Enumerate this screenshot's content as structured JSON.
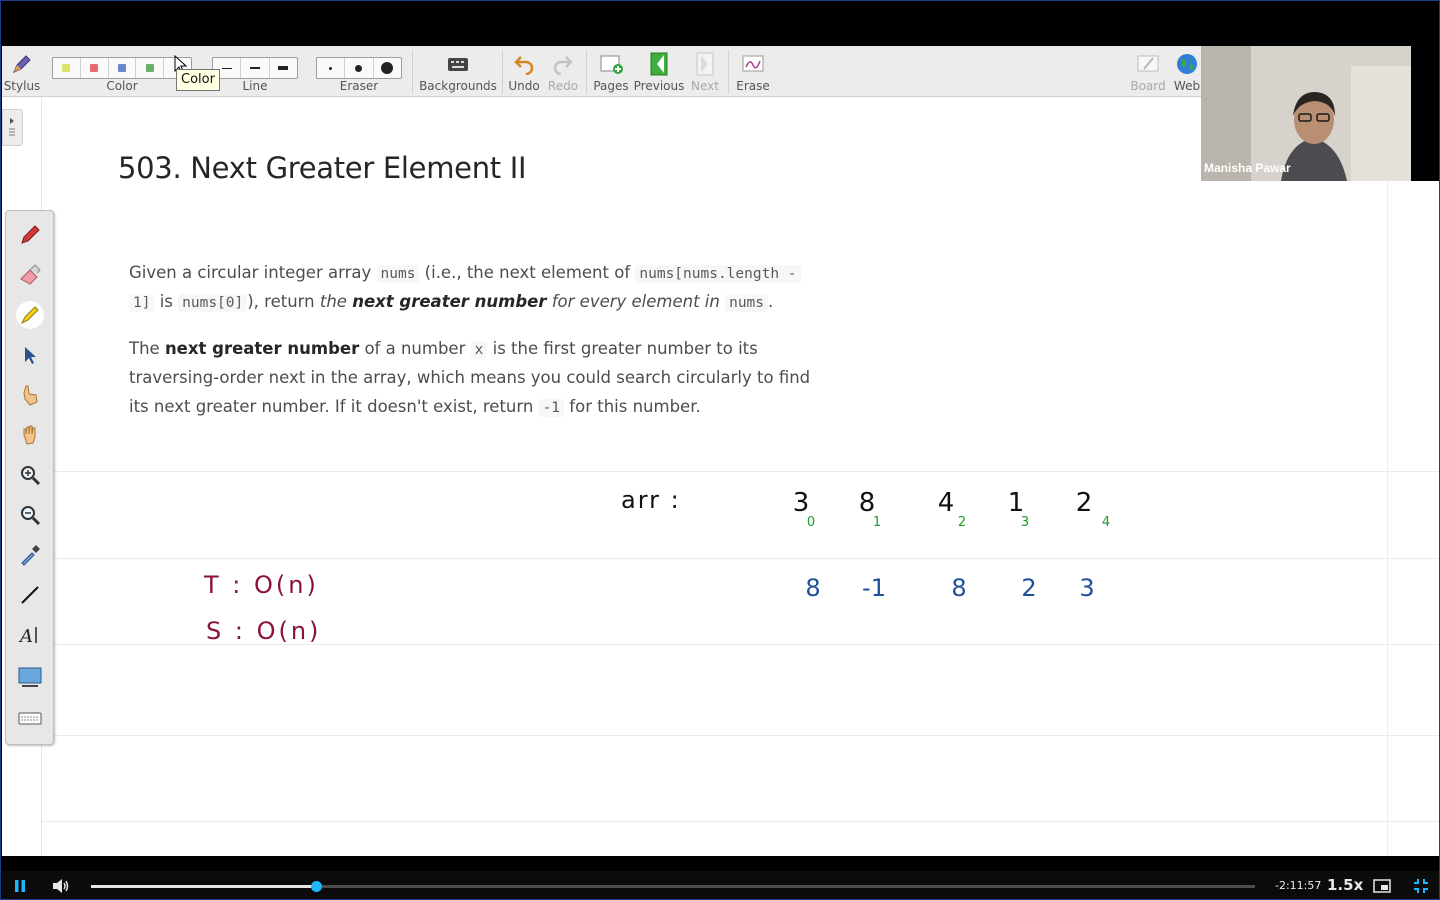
{
  "toolbar": {
    "stylus_label": "Stylus",
    "color_label": "Color",
    "color_swatches": [
      "#dce26b",
      "#e86a6a",
      "#6a86c8",
      "#6ab06a"
    ],
    "line_label": "Line",
    "eraser_label": "Eraser",
    "backgrounds_label": "Backgrounds",
    "undo_label": "Undo",
    "redo_label": "Redo",
    "pages_label": "Pages",
    "previous_label": "Previous",
    "next_label": "Next",
    "erase_label": "Erase",
    "board_label": "Board",
    "web_label": "Web"
  },
  "tooltip": {
    "text": "Color"
  },
  "webcam": {
    "name": "Manisha Pawar"
  },
  "problem": {
    "title": "503. Next Greater Element II",
    "p1_a": "Given a circular integer array ",
    "p1_code1": "nums",
    "p1_b": " (i.e., the next element of ",
    "p1_code2": "nums[nums.length -",
    "p1_code3": "1]",
    "p1_c": " is ",
    "p1_code4": "nums[0]",
    "p1_d": "), return ",
    "p1_e": "the ",
    "p1_f": "next greater number",
    "p1_g": " for every element in ",
    "p1_code5": "nums",
    "p1_h": ".",
    "p2_a": "The ",
    "p2_b": "next greater number",
    "p2_c": " of a number ",
    "p2_code1": "x",
    "p2_d": " is the first greater number to its",
    "p2_line2": "traversing-order next in the array, which means you could search circularly to find",
    "p2_e": "its next greater number. If it doesn't exist, return ",
    "p2_code2": "-1",
    "p2_f": " for this number."
  },
  "handwriting": {
    "arr_label": "arr :",
    "values": [
      "3",
      "8",
      "4",
      "1",
      "2"
    ],
    "indices": [
      "0",
      "1",
      "2",
      "3",
      "4"
    ],
    "results": [
      "8",
      "-1",
      "8",
      "2",
      "3"
    ],
    "time_complexity": "T : O(n)",
    "space_complexity": "S : O(n)",
    "colors": {
      "black": "#111111",
      "green": "#1d9a2a",
      "blue": "#1f4f9a",
      "maroon": "#8a1238"
    }
  },
  "player": {
    "progress": 0.193,
    "time_remaining": "-2:11:57",
    "speed": "1.5x"
  }
}
